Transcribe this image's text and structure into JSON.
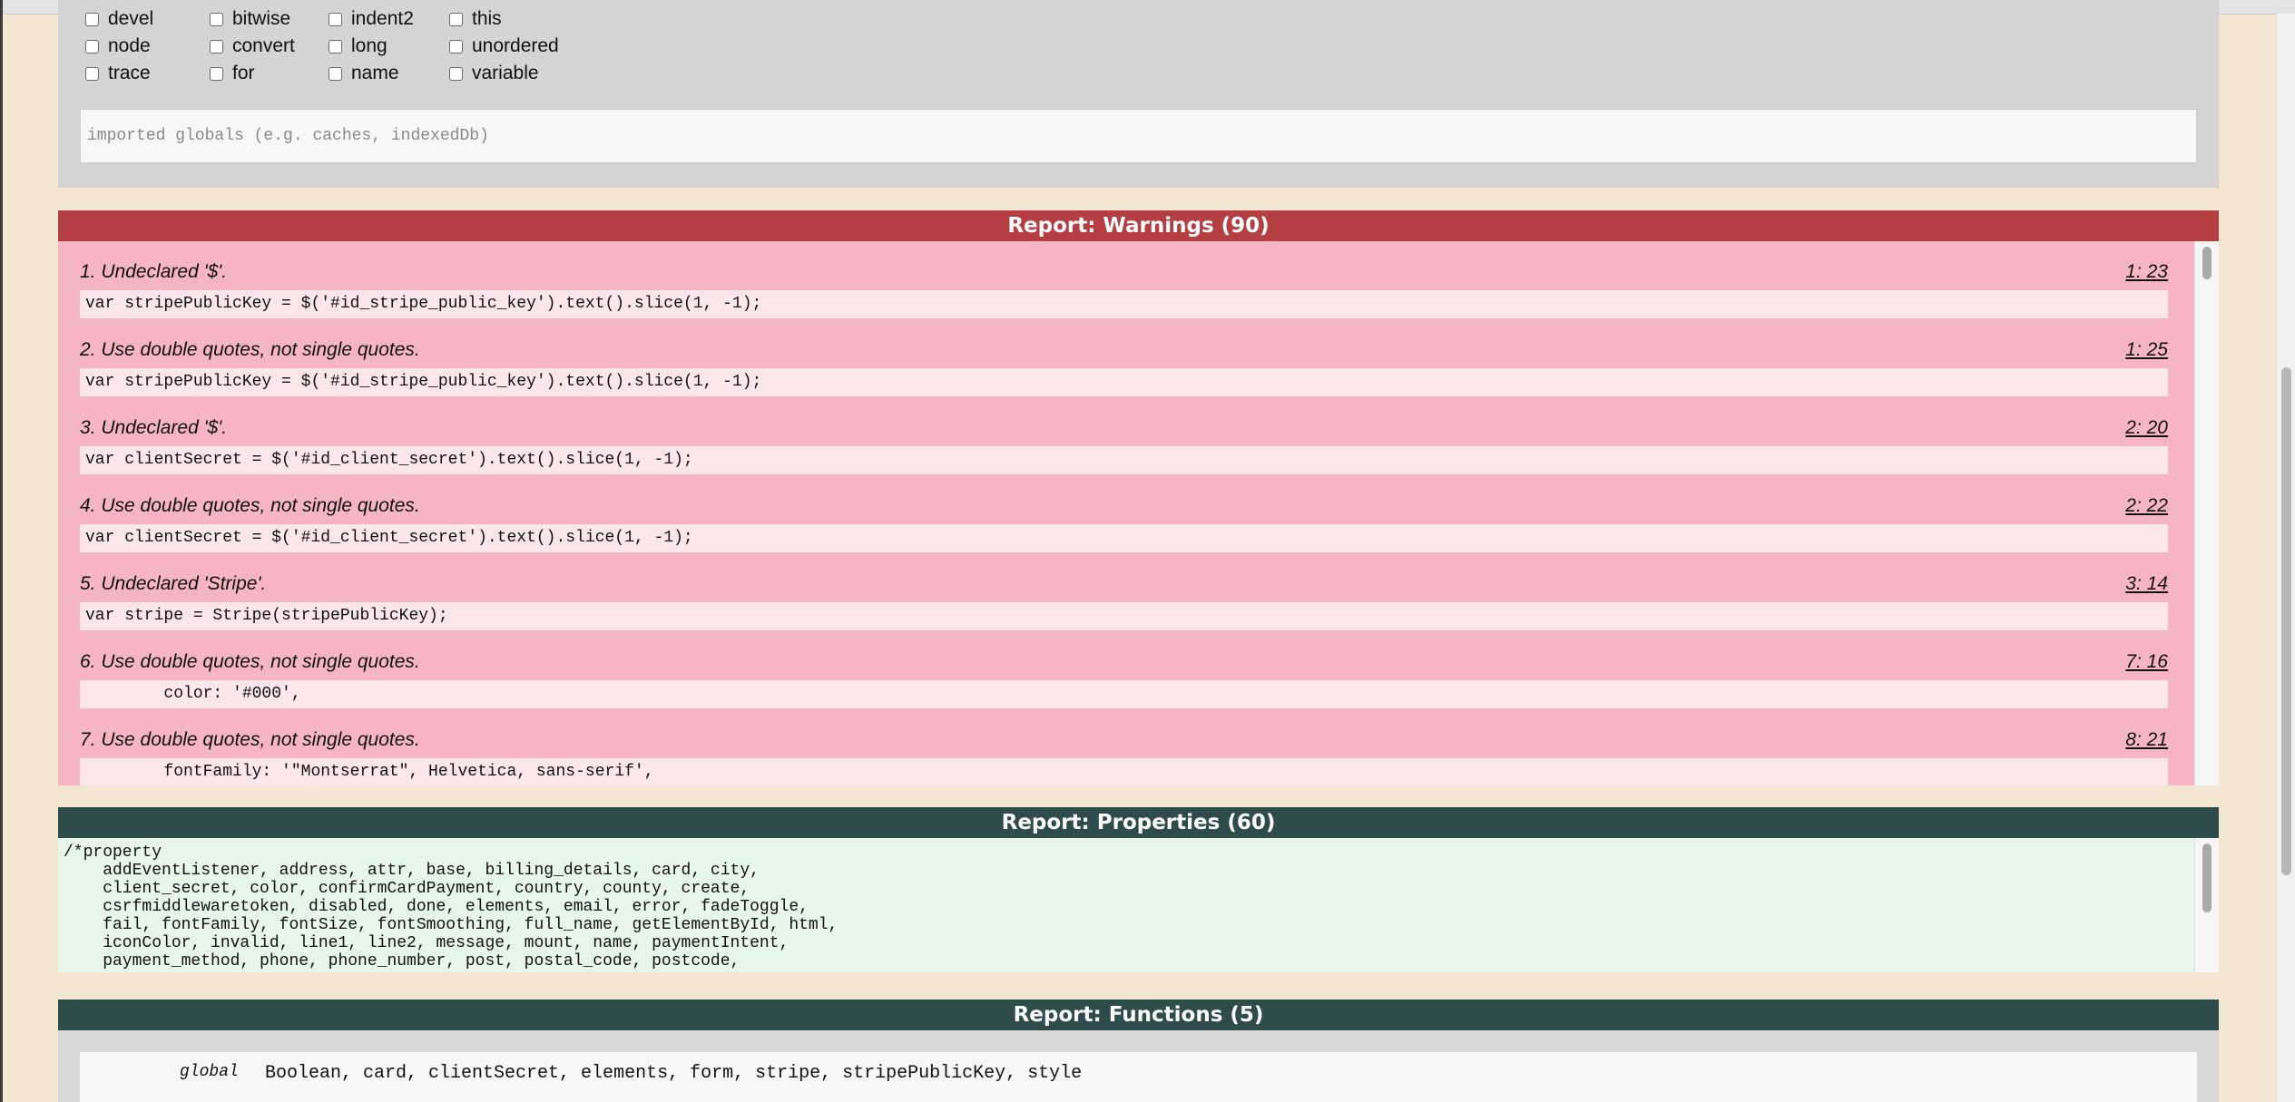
{
  "options": {
    "rows": [
      [
        "devel",
        "bitwise",
        "indent2",
        "this"
      ],
      [
        "node",
        "convert",
        "long",
        "unordered"
      ],
      [
        "trace",
        "for",
        "name",
        "variable"
      ]
    ],
    "globals_placeholder": "imported globals (e.g. caches, indexedDb)"
  },
  "warnings": {
    "title": "Report: Warnings (90)",
    "items": [
      {
        "message": "1. Undeclared '$'.",
        "location": "1: 23",
        "code": "var stripePublicKey = $('#id_stripe_public_key').text().slice(1, -1);"
      },
      {
        "message": "2. Use double quotes, not single quotes.",
        "location": "1: 25",
        "code": "var stripePublicKey = $('#id_stripe_public_key').text().slice(1, -1);"
      },
      {
        "message": "3. Undeclared '$'.",
        "location": "2: 20",
        "code": "var clientSecret = $('#id_client_secret').text().slice(1, -1);"
      },
      {
        "message": "4. Use double quotes, not single quotes.",
        "location": "2: 22",
        "code": "var clientSecret = $('#id_client_secret').text().slice(1, -1);"
      },
      {
        "message": "5. Undeclared 'Stripe'.",
        "location": "3: 14",
        "code": "var stripe = Stripe(stripePublicKey);"
      },
      {
        "message": "6. Use double quotes, not single quotes.",
        "location": "7: 16",
        "code": "        color: '#000',"
      },
      {
        "message": "7. Use double quotes, not single quotes.",
        "location": "8: 21",
        "code": "        fontFamily: '\"Montserrat\", Helvetica, sans-serif',"
      }
    ]
  },
  "properties": {
    "title": "Report: Properties (60)",
    "text": "/*property\n    addEventListener, address, attr, base, billing_details, card, city,\n    client_secret, color, confirmCardPayment, country, county, create,\n    csrfmiddlewaretoken, disabled, done, elements, email, error, fadeToggle,\n    fail, fontFamily, fontSize, fontSmoothing, full_name, getElementById, html,\n    iconColor, invalid, line1, line2, message, mount, name, paymentIntent,\n    payment_method, phone, phone_number, post, postal_code, postcode,"
  },
  "functions": {
    "title": "Report: Functions (5)",
    "label": "global",
    "value": "Boolean, card, clientSecret, elements, form, stripe, stripePublicKey, style"
  }
}
